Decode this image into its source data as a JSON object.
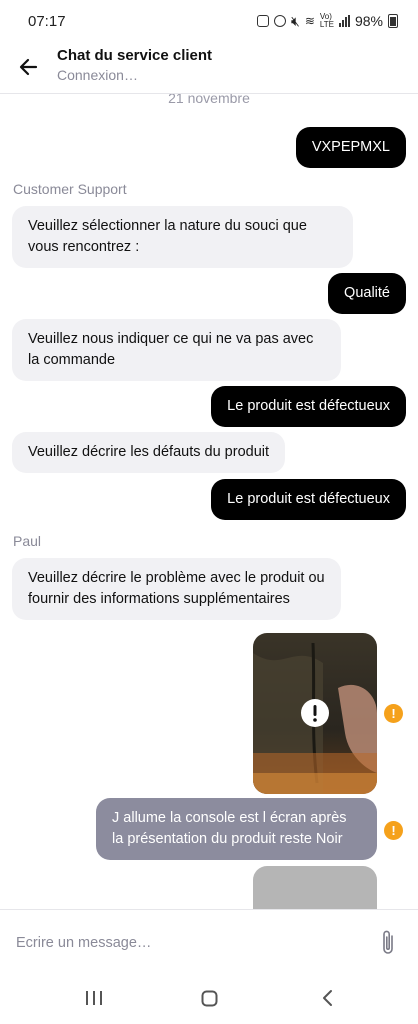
{
  "status_bar": {
    "time": "07:17",
    "battery": "98%"
  },
  "header": {
    "title": "Chat du service client",
    "subtitle": "Connexion…"
  },
  "chat": {
    "date": "21 novembre",
    "messages": [
      {
        "dir": "out",
        "text": "VXPEPMXL"
      },
      {
        "sender": "Customer Support"
      },
      {
        "dir": "in",
        "text": "Veuillez sélectionner la nature du souci que vous rencontrez :"
      },
      {
        "dir": "out",
        "text": "Qualité"
      },
      {
        "dir": "in",
        "text": "Veuillez nous indiquer ce qui ne va pas avec la commande"
      },
      {
        "dir": "out",
        "text": "Le produit est défectueux"
      },
      {
        "dir": "in",
        "text": "Veuillez décrire les défauts du produit"
      },
      {
        "dir": "out",
        "text": "Le produit est défectueux"
      },
      {
        "sender": "Paul"
      },
      {
        "dir": "in",
        "text": "Veuillez décrire le problème avec le produit ou fournir des informations supplémentaires"
      },
      {
        "dir": "out",
        "type": "image",
        "status": "failed",
        "status_icon": "exclamation-icon"
      },
      {
        "dir": "out",
        "text": "J allume la console est l écran après la présentation du produit reste Noir",
        "status": "failed"
      },
      {
        "dir": "out",
        "type": "image",
        "status": "uploading"
      }
    ]
  },
  "composer": {
    "placeholder": "Ecrire un message…",
    "attach_icon": "paperclip-icon"
  },
  "nav": {
    "recents_icon": "recents-icon",
    "home_icon": "home-icon",
    "back_icon": "back-icon"
  },
  "colors": {
    "outgoing": "#000000",
    "incoming": "#f1f1f4",
    "pending": "#8c8c9e",
    "warning": "#f5a11b",
    "muted": "#8a8a98"
  }
}
